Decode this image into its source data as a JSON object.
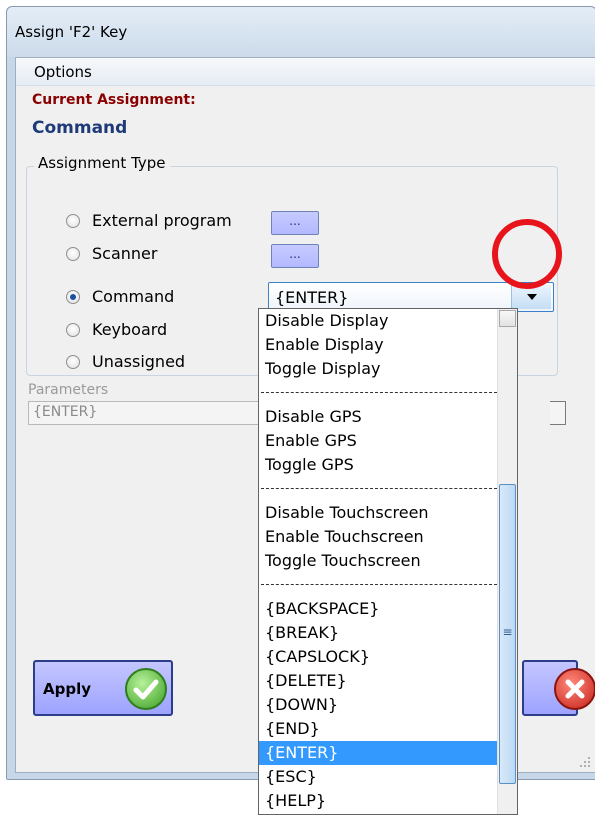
{
  "window": {
    "title": "Assign 'F2' Key"
  },
  "menu": {
    "options": "Options"
  },
  "current": {
    "label": "Current Assignment:",
    "value": "Command"
  },
  "assignment_type": {
    "title": "Assignment Type",
    "options": [
      {
        "label": "External program",
        "checked": false
      },
      {
        "label": "Scanner",
        "checked": false
      },
      {
        "label": "Command",
        "checked": true
      },
      {
        "label": "Keyboard",
        "checked": false
      },
      {
        "label": "Unassigned",
        "checked": false
      }
    ],
    "browse_label": "..."
  },
  "command_combo": {
    "value": "{ENTER}"
  },
  "parameters": {
    "label": "Parameters",
    "value": "{ENTER}"
  },
  "apply": {
    "label": "Apply"
  },
  "dropdown": {
    "items": [
      "Disable Display",
      "Enable Display",
      "Toggle Display",
      "------------------------------",
      "Disable GPS",
      "Enable GPS",
      "Toggle GPS",
      "------------------------------",
      "Disable Touchscreen",
      "Enable Touchscreen",
      "Toggle Touchscreen",
      "------------------------------",
      "{BACKSPACE}",
      "{BREAK}",
      "{CAPSLOCK}",
      "{DELETE}",
      "{DOWN}",
      "{END}",
      "{ENTER}",
      "{ESC}",
      "{HELP}"
    ],
    "selected": "{ENTER}"
  },
  "colors": {
    "current_label": "#8b0000",
    "current_value": "#1f3a78",
    "selection": "#3399ff",
    "highlight_circle": "#e8141c"
  }
}
